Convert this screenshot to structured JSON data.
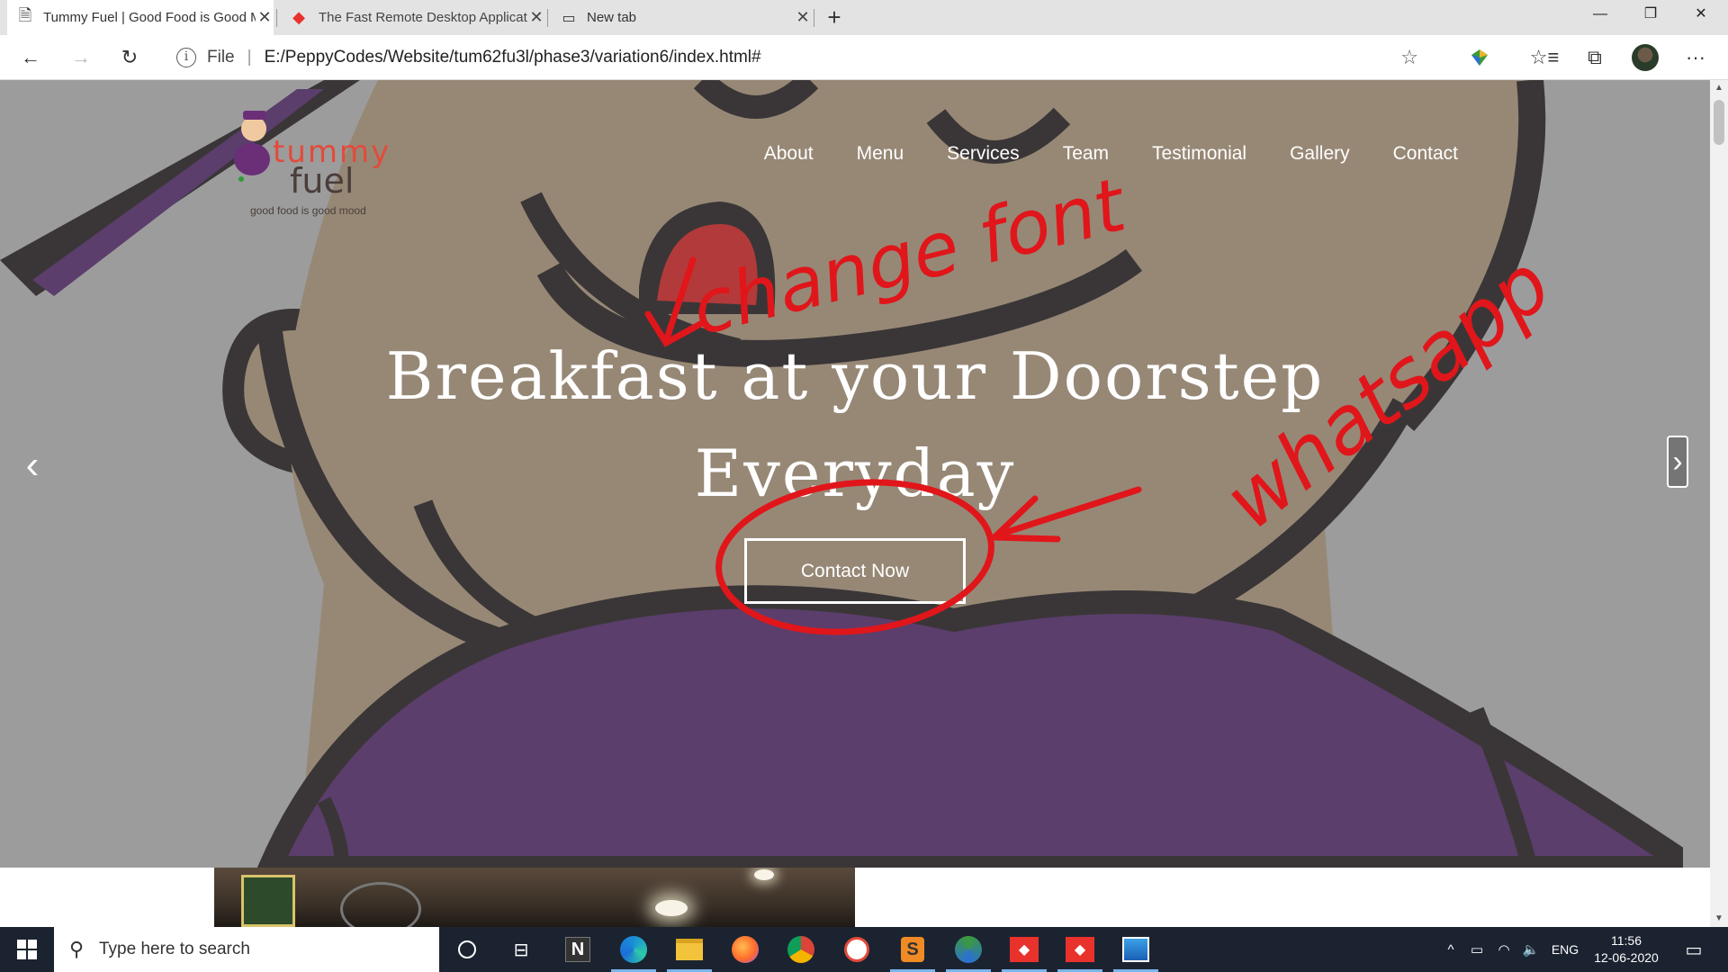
{
  "browser": {
    "tabs": [
      {
        "title": "Tummy Fuel | Good Food is Good Mood",
        "active": true
      },
      {
        "title": "The Fast Remote Desktop Application",
        "active": false
      },
      {
        "title": "New tab",
        "active": false
      }
    ],
    "address": {
      "scheme_label": "File",
      "url": "E:/PeppyCodes/Website/tum62fu3l/phase3/variation6/index.html#"
    }
  },
  "site": {
    "logo": {
      "line1": "tummy",
      "line2": "fuel",
      "tagline": "good food is good mood"
    },
    "nav": [
      "About",
      "Menu",
      "Services",
      "Team",
      "Testimonial",
      "Gallery",
      "Contact"
    ],
    "hero": {
      "headline_line1": "Breakfast at your Doorstep",
      "headline_line2": "Everyday",
      "cta": "Contact Now"
    }
  },
  "annotations": {
    "note1": "change font",
    "note2": "whatsapp",
    "color": "#e0161b"
  },
  "taskbar": {
    "search_placeholder": "Type here to search",
    "language": "ENG",
    "time": "11:56",
    "date": "12-06-2020"
  },
  "colors": {
    "hero_bg": "#9c9c9c",
    "face": "#978876",
    "outline": "#3a3637",
    "shirt": "#5b3e6c",
    "taskbar": "#1b2330"
  }
}
